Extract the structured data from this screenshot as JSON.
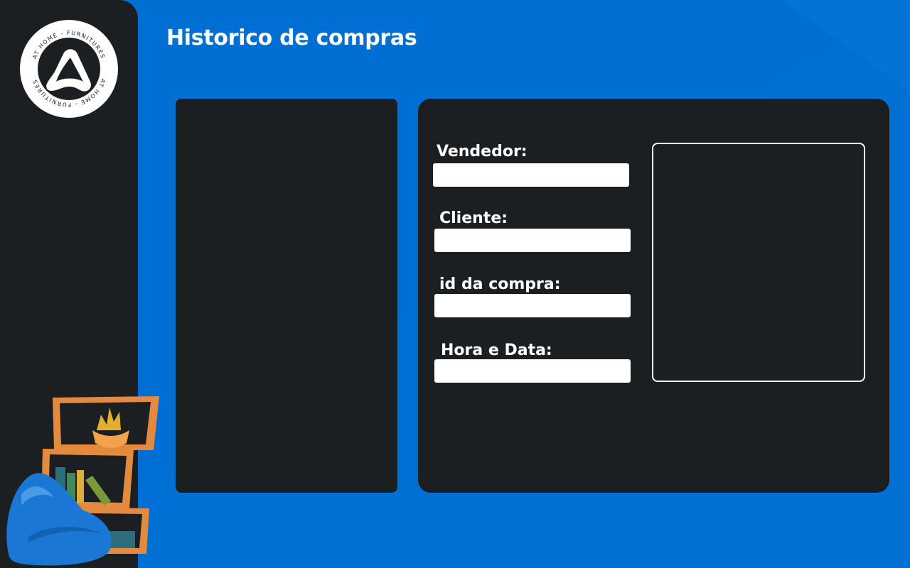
{
  "page": {
    "title": "Historico de compras"
  },
  "brand": {
    "ring_text": "AT HOME - FURNITURES"
  },
  "form": {
    "fields": [
      {
        "label": "Vendedor:",
        "value": ""
      },
      {
        "label": "Cliente:",
        "value": ""
      },
      {
        "label": "id da compra:",
        "value": ""
      },
      {
        "label": "Hora e Data:",
        "value": ""
      }
    ]
  },
  "colors": {
    "background": "#006ed2",
    "panel": "#1c1f22",
    "text": "#ffffff"
  },
  "icons": {
    "logo": "at-home-logo-icon",
    "illustration": "shelf-and-beanbag-icon"
  }
}
